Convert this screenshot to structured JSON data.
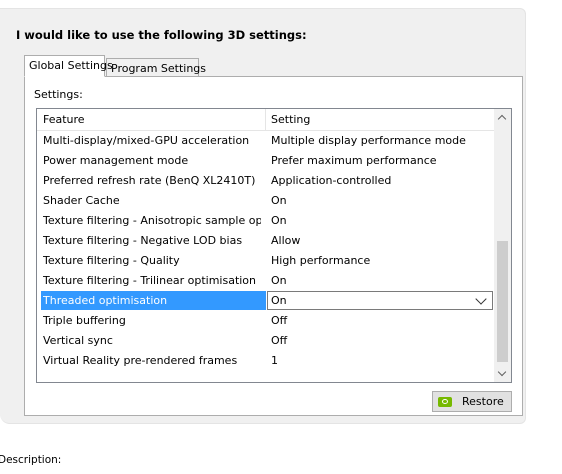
{
  "heading": "I would like to use the following 3D settings:",
  "tabs": [
    {
      "label": "Global Settings",
      "active": true
    },
    {
      "label": "Program Settings",
      "active": false
    }
  ],
  "settings_label": "Settings:",
  "columns": {
    "feature": "Feature",
    "setting": "Setting"
  },
  "rows": [
    {
      "feature": "Multi-display/mixed-GPU acceleration",
      "setting": "Multiple display performance mode"
    },
    {
      "feature": "Power management mode",
      "setting": "Prefer maximum performance"
    },
    {
      "feature": "Preferred refresh rate (BenQ XL2410T)",
      "setting": "Application-controlled"
    },
    {
      "feature": "Shader Cache",
      "setting": "On"
    },
    {
      "feature": "Texture filtering - Anisotropic sample opti...",
      "setting": "On"
    },
    {
      "feature": "Texture filtering - Negative LOD bias",
      "setting": "Allow"
    },
    {
      "feature": "Texture filtering - Quality",
      "setting": "High performance"
    },
    {
      "feature": "Texture filtering - Trilinear optimisation",
      "setting": "On"
    },
    {
      "feature": "Threaded optimisation",
      "setting": "On",
      "selected": true
    },
    {
      "feature": "Triple buffering",
      "setting": "Off"
    },
    {
      "feature": "Vertical sync",
      "setting": "Off"
    },
    {
      "feature": "Virtual Reality pre-rendered frames",
      "setting": "1"
    }
  ],
  "restore_label": "Restore",
  "description_label": "Description:",
  "icons": {
    "restore": "nvidia-logo-icon",
    "dropdown": "chevron-down-icon"
  },
  "colors": {
    "selection": "#3399ff",
    "nvidia_green": "#76b900"
  }
}
